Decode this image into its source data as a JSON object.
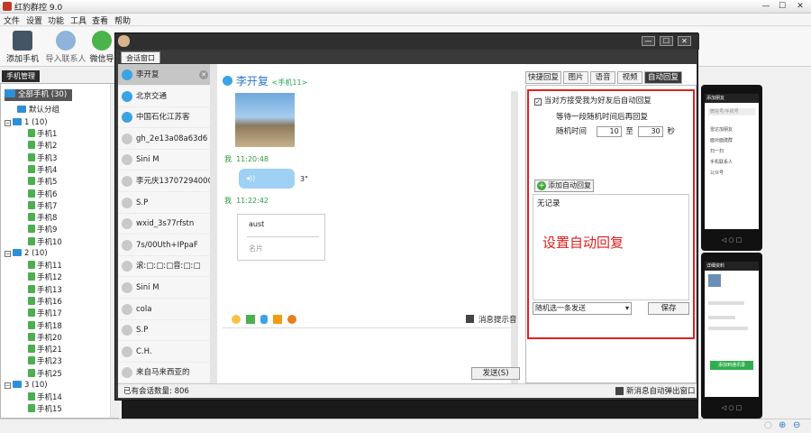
{
  "window": {
    "title": "红豹群控 9.0"
  },
  "menu": [
    "文件",
    "设置",
    "功能",
    "工具",
    "查看",
    "帮助"
  ],
  "toolbar": {
    "add_phone": "添加手机",
    "import_contacts": "导入联系人",
    "wechat_import": "微信导"
  },
  "tree": {
    "tab": "手机管理",
    "root": "全部手机 (30)",
    "default_group": "默认分组",
    "group1": "1 (10)",
    "group1_items": [
      "手机1",
      "手机2",
      "手机3",
      "手机4",
      "手机5",
      "手机6",
      "手机7",
      "手机8",
      "手机9",
      "手机10"
    ],
    "group2": "2 (10)",
    "group2_items": [
      "手机11",
      "手机12",
      "手机13",
      "手机16",
      "手机17",
      "手机18",
      "手机20",
      "手机21",
      "手机23",
      "手机25"
    ],
    "group3": "3 (10)",
    "group3_items": [
      "手机14",
      "手机15"
    ]
  },
  "dialog": {
    "tab": "会话窗口"
  },
  "contacts": {
    "items": [
      {
        "name": "李开复",
        "blue": true
      },
      {
        "name": "北京交通",
        "blue": true
      },
      {
        "name": "中国石化江苏客",
        "blue": true
      },
      {
        "name": "gh_2e13a08a63d6",
        "blue": false
      },
      {
        "name": "Sini M",
        "blue": false
      },
      {
        "name": "李元庆13707294000",
        "blue": false
      },
      {
        "name": "S.P",
        "blue": false
      },
      {
        "name": "wxid_3s77rfstn",
        "blue": false
      },
      {
        "name": "7s/00Uth+IPpaF",
        "blue": false
      },
      {
        "name": "滚ː□ː□ː□音ː□ː□",
        "blue": false
      },
      {
        "name": "Sini M",
        "blue": false
      },
      {
        "name": "cola",
        "blue": false
      },
      {
        "name": "S.P",
        "blue": false
      },
      {
        "name": "C.H.",
        "blue": false
      },
      {
        "name": "来自马来西亚的",
        "blue": false
      }
    ],
    "count_label": "已有会话数量: 806"
  },
  "chat": {
    "name": "李开复",
    "phone": "<手机11>",
    "me": "我",
    "time1": "11:20:48",
    "voice_len": "3\"",
    "time2": "11:22:42",
    "card_name": "aust",
    "card_label": "名片",
    "notify": "消息提示音",
    "send": "发送(S)",
    "popup": "新消息自动弹出窗口"
  },
  "right": {
    "tabs": [
      "快捷回复",
      "图片",
      "语音",
      "视频",
      "自动回复"
    ],
    "auto_reply_check": "当对方接受我为好友后自动回复",
    "wait_text": "等待一段随机时间后再回复",
    "random_time": "随机时间",
    "from": "10",
    "to_label": "至",
    "to": "30",
    "unit": "秒",
    "add_btn": "添加自动回复",
    "no_record": "无记录",
    "annotation": "设置自动回复",
    "select": "随机选一条发送",
    "save": "保存"
  },
  "phones": {
    "p1_title": "添加朋友",
    "p1_search": "微信号/手机号",
    "p1_items": [
      "雷达加朋友",
      "面对面建群",
      "扫一扫",
      "手机联系人",
      "公众号"
    ],
    "p2_title": "详细资料",
    "p2_btn": "添加到通讯录"
  },
  "colors": {
    "accent": "#2a78c2",
    "red": "#e02020",
    "me_green": "#2e9b3a"
  }
}
